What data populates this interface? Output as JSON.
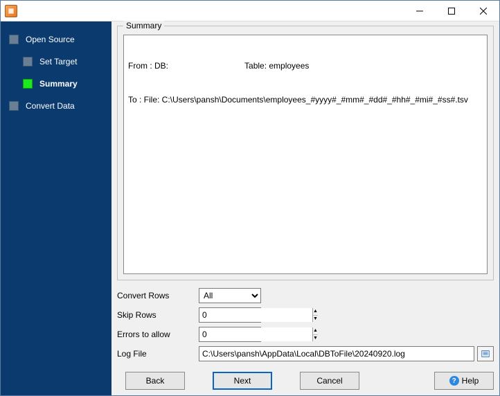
{
  "sidebar": {
    "items": [
      {
        "label": "Open Source",
        "current": false,
        "sub": false
      },
      {
        "label": "Set Target",
        "current": false,
        "sub": true
      },
      {
        "label": "Summary",
        "current": true,
        "sub": true
      },
      {
        "label": "Convert Data",
        "current": false,
        "sub": false
      }
    ]
  },
  "summary": {
    "title": "Summary",
    "from_label": "From : DB:",
    "table_label": "Table: employees",
    "to_line": "To : File: C:\\Users\\pansh\\Documents\\employees_#yyyy#_#mm#_#dd#_#hh#_#mi#_#ss#.tsv"
  },
  "form": {
    "convert_rows": {
      "label": "Convert Rows",
      "value": "All"
    },
    "skip_rows": {
      "label": "Skip Rows",
      "value": "0"
    },
    "errors_allow": {
      "label": "Errors to allow",
      "value": "0"
    },
    "log_file": {
      "label": "Log File",
      "value": "C:\\Users\\pansh\\AppData\\Local\\DBToFile\\20240920.log"
    }
  },
  "buttons": {
    "back": "Back",
    "next": "Next",
    "cancel": "Cancel",
    "help": "Help"
  }
}
